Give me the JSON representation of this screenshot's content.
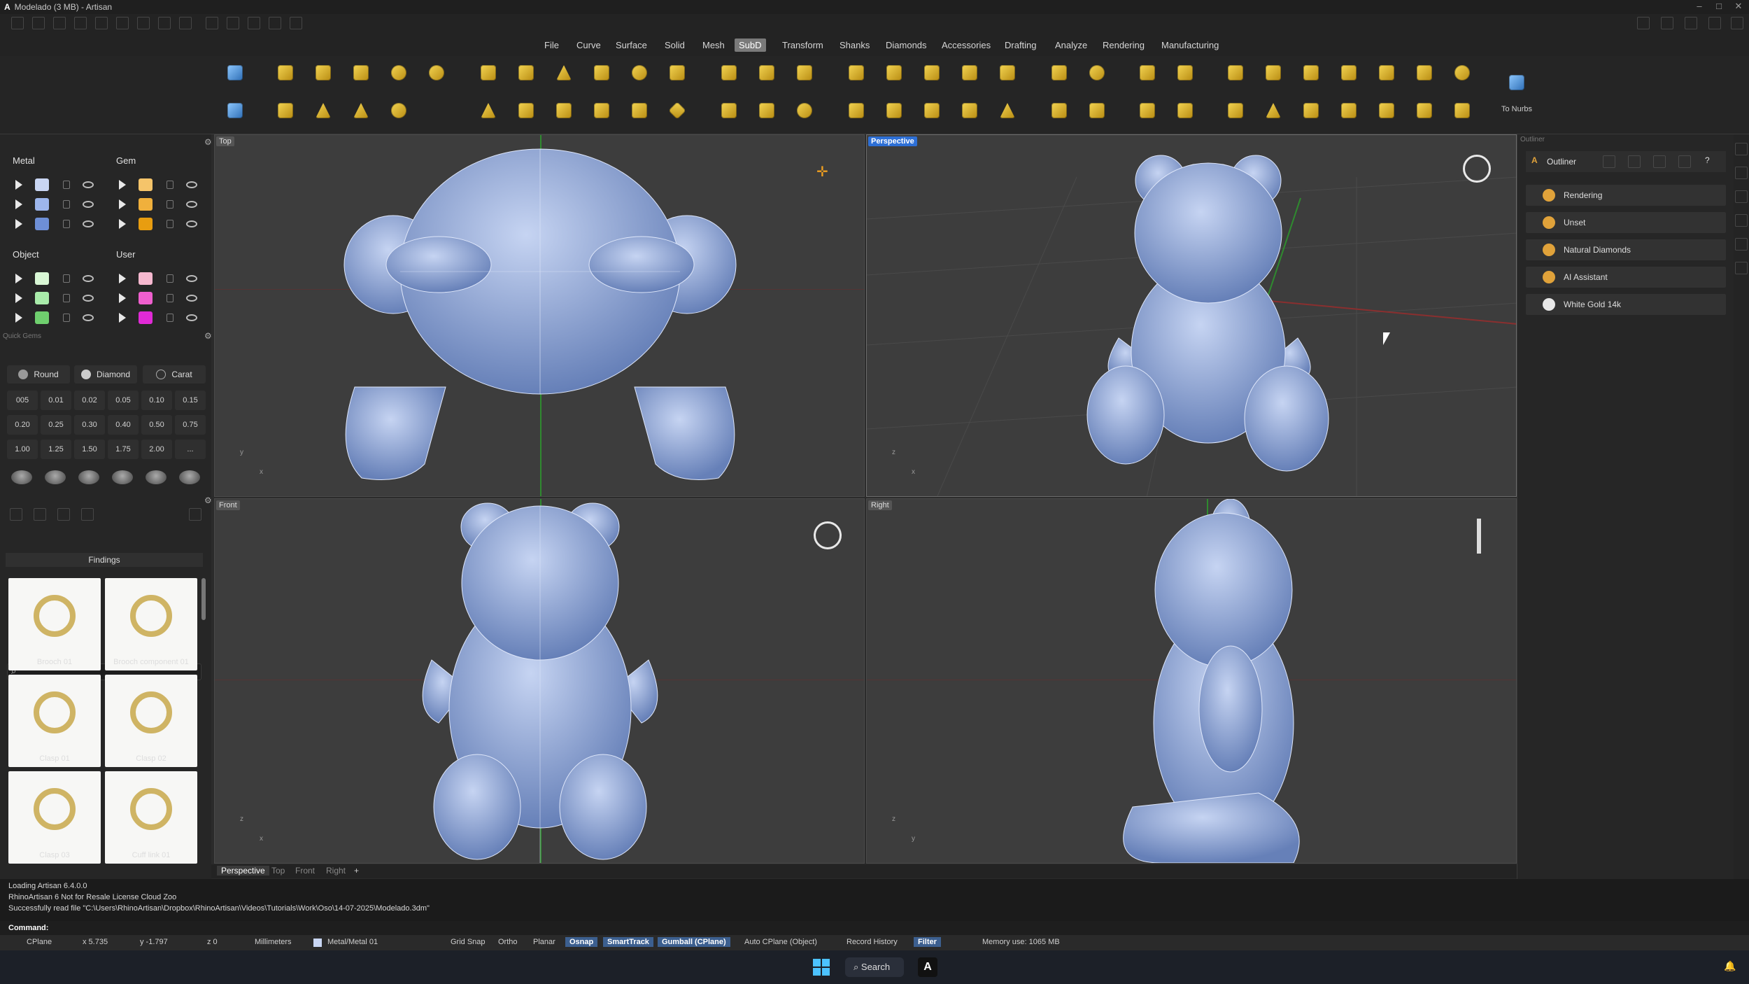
{
  "window": {
    "title": "Modelado (3 MB) - Artisan",
    "logo": "A"
  },
  "menu": {
    "items": [
      "File",
      "Curve",
      "Surface",
      "Solid",
      "Mesh",
      "SubD",
      "Transform",
      "Shanks",
      "Diamonds",
      "Accessories",
      "Drafting",
      "Analyze",
      "Rendering",
      "Manufacturing"
    ],
    "active": "SubD"
  },
  "ribbon": {
    "to_nurbs_label": "To Nurbs"
  },
  "layers": {
    "metal": {
      "title": "Metal",
      "colors": [
        "#c9d6f3",
        "#9db6ec",
        "#6e8fd6"
      ]
    },
    "gem": {
      "title": "Gem",
      "colors": [
        "#f5c46a",
        "#f0b03c",
        "#e89d10"
      ]
    },
    "object": {
      "title": "Object",
      "colors": [
        "#d9f7d5",
        "#a9ecaa",
        "#6fcf6e"
      ]
    },
    "user": {
      "title": "User",
      "colors": [
        "#f6b8cf",
        "#ef5fce",
        "#e02ad6"
      ]
    }
  },
  "quick_gems": {
    "title": "Quick Gems",
    "shape_button": "Round",
    "type_button": "Diamond",
    "unit_button": "Carat",
    "sizes": [
      [
        "005",
        "0.01",
        "0.02",
        "0.05",
        "0.10",
        "0.15"
      ],
      [
        "0.20",
        "0.25",
        "0.30",
        "0.40",
        "0.50",
        "0.75"
      ],
      [
        "1.00",
        "1.25",
        "1.50",
        "1.75",
        "2.00",
        "..."
      ]
    ]
  },
  "library": {
    "search_placeholder": "",
    "category": "Findings",
    "items": [
      {
        "label": "Brooch 01",
        "icon": "brooch-icon"
      },
      {
        "label": "Brooch component 01",
        "icon": "brooch-component-icon"
      },
      {
        "label": "Clasp 01",
        "icon": "clasp-icon"
      },
      {
        "label": "Clasp 02",
        "icon": "clasp-icon"
      },
      {
        "label": "Clasp 03",
        "icon": "clasp-icon"
      },
      {
        "label": "Cuff link 01",
        "icon": "cufflink-icon"
      }
    ]
  },
  "viewports": {
    "top": {
      "label": "Top",
      "axis_y": "y",
      "axis_x": "x"
    },
    "perspective": {
      "label": "Perspective",
      "axis_y": "z",
      "axis_x": "x"
    },
    "front": {
      "label": "Front",
      "axis_y": "z",
      "axis_x": "x"
    },
    "right": {
      "label": "Right",
      "axis_y": "z",
      "axis_x": "y"
    }
  },
  "viewport_tabs": [
    "Perspective",
    "Top",
    "Front",
    "Right"
  ],
  "viewport_tabs_active": "Perspective",
  "outliner": {
    "title": "Outliner",
    "header": "Outliner",
    "rows": [
      {
        "label": "Rendering",
        "icon": "palette-icon",
        "color": "#e0a23a"
      },
      {
        "label": "Unset",
        "icon": "pen-icon",
        "color": "#e0a23a"
      },
      {
        "label": "Natural Diamonds",
        "icon": "diamond-icon",
        "color": "#e0a23a"
      },
      {
        "label": "AI Assistant",
        "icon": "assistant-icon",
        "color": "#e0a23a"
      },
      {
        "label": "White Gold 14k",
        "icon": "sphere-icon",
        "color": "#e8e8e8"
      }
    ]
  },
  "command": {
    "history": [
      "Loading Artisan 6.4.0.0",
      "RhinoArtisan 6 Not for Resale License Cloud Zoo",
      "Successfully read file \"C:\\Users\\RhinoArtisan\\Dropbox\\RhinoArtisan\\Videos\\Tutorials\\Work\\Oso\\14-07-2025\\Modelado.3dm\""
    ],
    "prompt": "Command:"
  },
  "status": {
    "cplane": "CPlane",
    "x": "x 5.735",
    "y": "y -1.797",
    "z": "z 0",
    "units": "Millimeters",
    "layer": "Metal/Metal 01",
    "toggles": [
      {
        "label": "Grid Snap",
        "on": false
      },
      {
        "label": "Ortho",
        "on": false
      },
      {
        "label": "Planar",
        "on": false
      },
      {
        "label": "Osnap",
        "on": true
      },
      {
        "label": "SmartTrack",
        "on": true
      },
      {
        "label": "Gumball (CPlane)",
        "on": true
      },
      {
        "label": "Auto CPlane (Object)",
        "on": false
      },
      {
        "label": "Record History",
        "on": false
      },
      {
        "label": "Filter",
        "on": true
      }
    ],
    "memory": "Memory use: 1065 MB"
  },
  "taskbar": {
    "search_label": "Search"
  },
  "colors": {
    "model": "#9cb2de",
    "accent": "#2d6fd6"
  }
}
